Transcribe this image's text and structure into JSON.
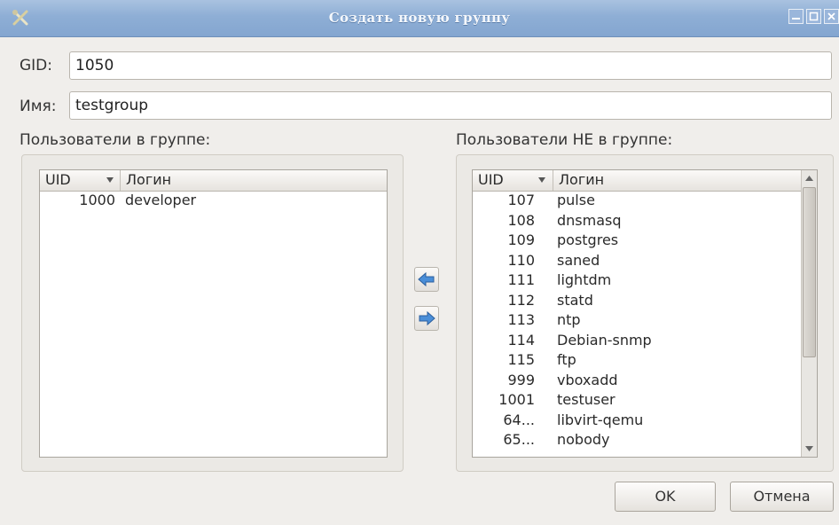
{
  "window": {
    "title": "Создать новую группу"
  },
  "form": {
    "gid_label": "GID:",
    "gid_value": "1050",
    "name_label": "Имя:",
    "name_value": "testgroup"
  },
  "members": {
    "label": "Пользователи в группе:",
    "columns": [
      "UID",
      "Логин"
    ],
    "rows": [
      {
        "uid": "1000",
        "login": "developer"
      }
    ]
  },
  "non_members": {
    "label": "Пользователи НЕ в группе:",
    "columns": [
      "UID",
      "Логин"
    ],
    "rows": [
      {
        "uid": "107",
        "login": "pulse"
      },
      {
        "uid": "108",
        "login": "dnsmasq"
      },
      {
        "uid": "109",
        "login": "postgres"
      },
      {
        "uid": "110",
        "login": "saned"
      },
      {
        "uid": "111",
        "login": "lightdm"
      },
      {
        "uid": "112",
        "login": "statd"
      },
      {
        "uid": "113",
        "login": "ntp"
      },
      {
        "uid": "114",
        "login": "Debian-snmp"
      },
      {
        "uid": "115",
        "login": "ftp"
      },
      {
        "uid": "999",
        "login": "vboxadd"
      },
      {
        "uid": "1001",
        "login": "testuser"
      },
      {
        "uid": "64...",
        "login": "libvirt-qemu"
      },
      {
        "uid": "65...",
        "login": "nobody"
      }
    ]
  },
  "buttons": {
    "ok": "OK",
    "cancel": "Отмена"
  },
  "icons": {
    "app": "tools-icon",
    "move_left": "arrow-left-icon",
    "move_right": "arrow-right-icon"
  },
  "colors": {
    "titlebar": "#8eaed5",
    "arrow_fill": "#4a8ed8"
  }
}
